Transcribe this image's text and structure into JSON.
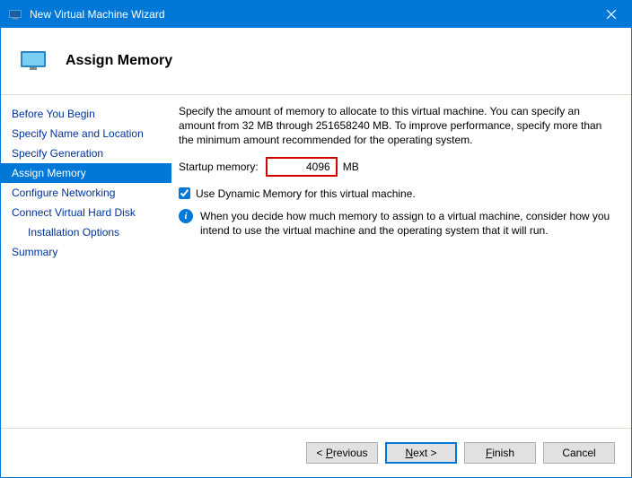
{
  "window": {
    "title": "New Virtual Machine Wizard"
  },
  "header": {
    "title": "Assign Memory"
  },
  "sidebar": {
    "items": [
      {
        "label": "Before You Begin"
      },
      {
        "label": "Specify Name and Location"
      },
      {
        "label": "Specify Generation"
      },
      {
        "label": "Assign Memory"
      },
      {
        "label": "Configure Networking"
      },
      {
        "label": "Connect Virtual Hard Disk"
      },
      {
        "label": "Installation Options"
      },
      {
        "label": "Summary"
      }
    ],
    "selected_index": 3
  },
  "content": {
    "description": "Specify the amount of memory to allocate to this virtual machine. You can specify an amount from 32 MB through 251658240 MB. To improve performance, specify more than the minimum amount recommended for the operating system.",
    "startup_label": "Startup memory:",
    "startup_value": "4096",
    "startup_unit": "MB",
    "dynamic_memory_label": "Use Dynamic Memory for this virtual machine.",
    "dynamic_memory_checked": true,
    "info_text": "When you decide how much memory to assign to a virtual machine, consider how you intend to use the virtual machine and the operating system that it will run."
  },
  "footer": {
    "previous": "< Previous",
    "next": "Next >",
    "finish": "Finish",
    "cancel": "Cancel"
  }
}
